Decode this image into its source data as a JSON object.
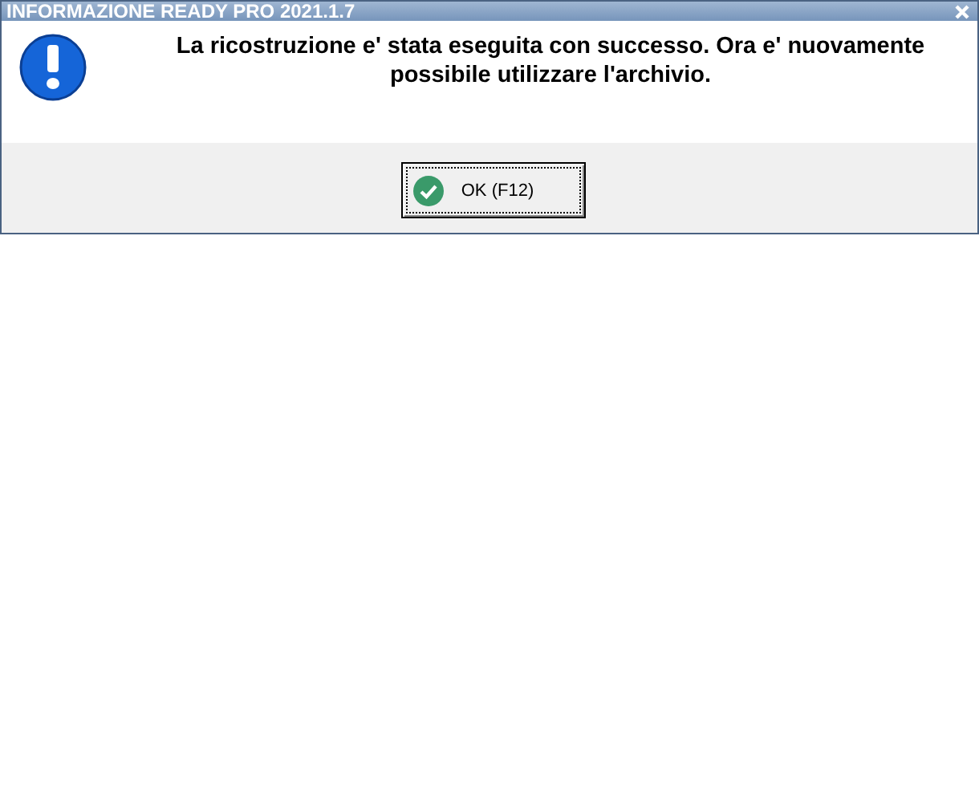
{
  "window": {
    "title": "INFORMAZIONE READY PRO 2021.1.7"
  },
  "message": "La ricostruzione e' stata eseguita con successo. Ora e' nuovamente possibile utilizzare l'archivio.",
  "buttons": [
    {
      "label": "OK (F12)",
      "focused": true
    }
  ]
}
